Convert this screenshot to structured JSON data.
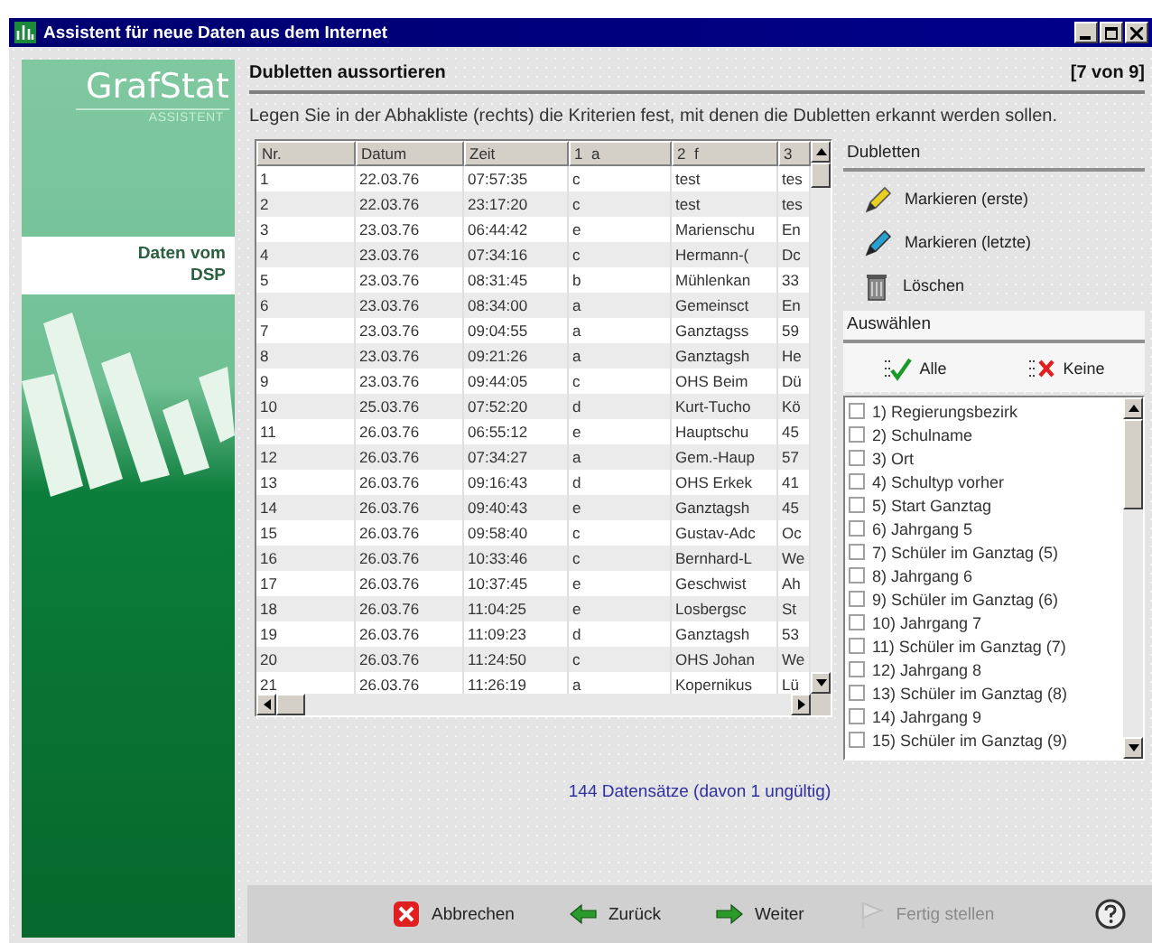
{
  "window": {
    "title": "Assistent für neue Daten aus dem Internet"
  },
  "sidebar": {
    "logo": "GrafStat",
    "subtitle": "ASSISTENT",
    "step_label": "Daten vom DSP"
  },
  "header": {
    "title": "Dubletten aussortieren",
    "step": "[7 von 9]",
    "description": "Legen Sie in der Abhakliste (rechts) die Kriterien fest, mit denen die Dubletten erkannt werden sollen."
  },
  "table": {
    "columns": [
      "Nr.",
      "Datum",
      "Zeit",
      "1  a",
      "2  f",
      "3"
    ],
    "rows": [
      [
        "1",
        "22.03.76",
        "07:57:35",
        "c",
        "test",
        "tes"
      ],
      [
        "2",
        "22.03.76",
        "23:17:20",
        "c",
        "test",
        "tes"
      ],
      [
        "3",
        "23.03.76",
        "06:44:42",
        "e",
        "Marienschu",
        "En"
      ],
      [
        "4",
        "23.03.76",
        "07:34:16",
        "c",
        "Hermann-(",
        "Dc"
      ],
      [
        "5",
        "23.03.76",
        "08:31:45",
        "b",
        "Mühlenkan",
        "33"
      ],
      [
        "6",
        "23.03.76",
        "08:34:00",
        "a",
        "Gemeinsct",
        "En"
      ],
      [
        "7",
        "23.03.76",
        "09:04:55",
        "a",
        "Ganztagss",
        "59"
      ],
      [
        "8",
        "23.03.76",
        "09:21:26",
        "a",
        "Ganztagsh",
        "He"
      ],
      [
        "9",
        "23.03.76",
        "09:44:05",
        "c",
        "OHS Beim",
        "Dü"
      ],
      [
        "10",
        "25.03.76",
        "07:52:20",
        "d",
        "Kurt-Tucho",
        "Kö"
      ],
      [
        "11",
        "26.03.76",
        "06:55:12",
        "e",
        "Hauptschu",
        "45"
      ],
      [
        "12",
        "26.03.76",
        "07:34:27",
        "a",
        "Gem.-Haup",
        "57"
      ],
      [
        "13",
        "26.03.76",
        "09:16:43",
        "d",
        "OHS Erkek",
        "41"
      ],
      [
        "14",
        "26.03.76",
        "09:40:43",
        "e",
        "Ganztagsh",
        "45"
      ],
      [
        "15",
        "26.03.76",
        "09:58:40",
        "c",
        "Gustav-Adc",
        "Oc"
      ],
      [
        "16",
        "26.03.76",
        "10:33:46",
        "c",
        "Bernhard-L",
        "We"
      ],
      [
        "17",
        "26.03.76",
        "10:37:45",
        "e",
        "Geschwist",
        "Ah"
      ],
      [
        "18",
        "26.03.76",
        "11:04:25",
        "e",
        "Losbergsc",
        "St"
      ],
      [
        "19",
        "26.03.76",
        "11:09:23",
        "d",
        "Ganztagsh",
        "53"
      ],
      [
        "20",
        "26.03.76",
        "11:24:50",
        "c",
        "OHS Johan",
        "We"
      ],
      [
        "21",
        "26.03.76",
        "11:26:19",
        "a",
        "Kopernikus",
        "Lü"
      ]
    ]
  },
  "record_count": "144 Datensätze (davon 1 ungültig)",
  "duplicates": {
    "title": "Dubletten",
    "actions": [
      {
        "label": "Markieren (erste)",
        "kind": "mark-first"
      },
      {
        "label": "Markieren (letzte)",
        "kind": "mark-last"
      },
      {
        "label": "Löschen",
        "kind": "delete"
      }
    ]
  },
  "selection": {
    "title": "Auswählen",
    "all": "Alle",
    "none": "Keine",
    "items": [
      {
        "label": "1) Regierungsbezirk",
        "checked": false
      },
      {
        "label": "2) Schulname",
        "checked": false
      },
      {
        "label": "3) Ort",
        "checked": false
      },
      {
        "label": "4) Schultyp vorher",
        "checked": false
      },
      {
        "label": "5) Start Ganztag",
        "checked": false
      },
      {
        "label": "6) Jahrgang 5",
        "checked": false
      },
      {
        "label": "7) Schüler im Ganztag (5)",
        "checked": false
      },
      {
        "label": "8) Jahrgang 6",
        "checked": false
      },
      {
        "label": "9) Schüler im Ganztag (6)",
        "checked": false
      },
      {
        "label": "10) Jahrgang 7",
        "checked": false
      },
      {
        "label": "11) Schüler im Ganztag (7)",
        "checked": false
      },
      {
        "label": "12) Jahrgang 8",
        "checked": false
      },
      {
        "label": "13) Schüler im Ganztag (8)",
        "checked": false
      },
      {
        "label": "14) Jahrgang 9",
        "checked": false
      },
      {
        "label": "15) Schüler im Ganztag (9)",
        "checked": false
      }
    ]
  },
  "buttons": [
    {
      "label": "Abbrechen",
      "kind": "cancel",
      "disabled": false
    },
    {
      "label": "Zurück",
      "kind": "back",
      "disabled": false
    },
    {
      "label": "Weiter",
      "kind": "next",
      "disabled": false
    },
    {
      "label": "Fertig stellen",
      "kind": "finish",
      "disabled": true
    },
    {
      "kind": "help"
    }
  ]
}
